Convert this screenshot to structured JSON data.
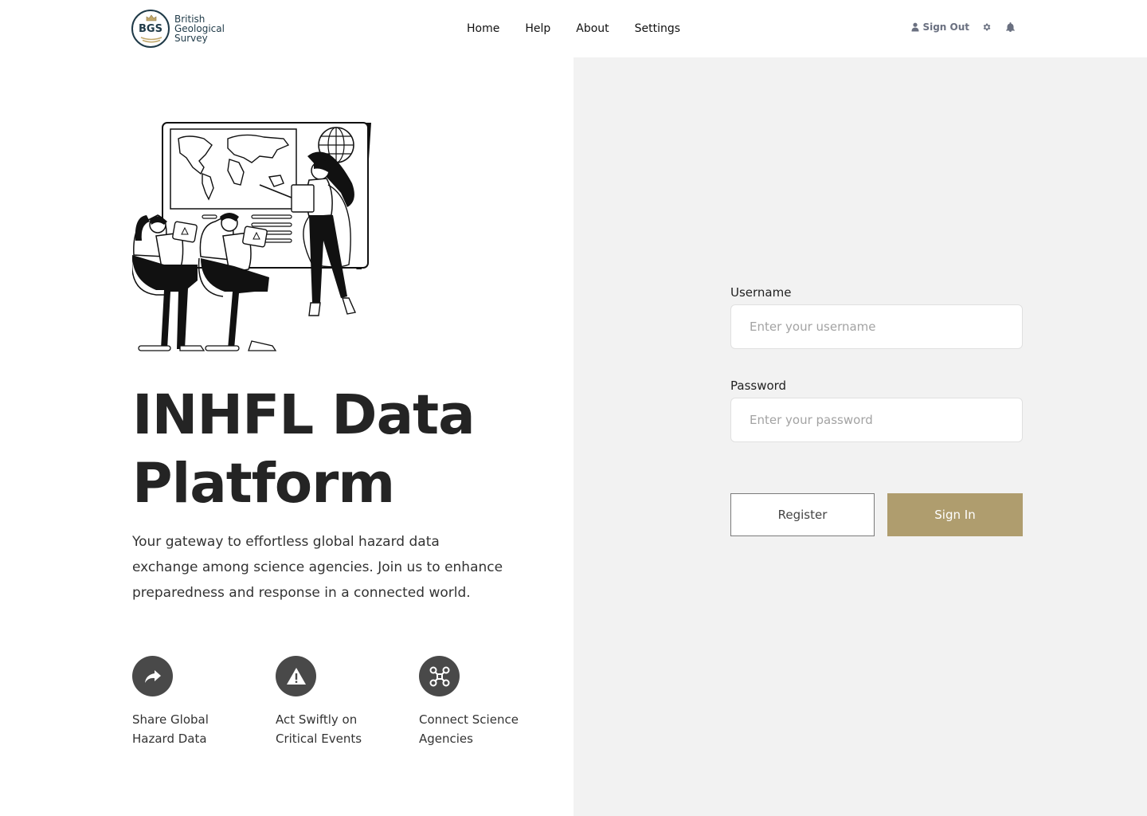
{
  "header": {
    "logo": {
      "abbr": "BGS",
      "words": [
        "British",
        "Geological",
        "Survey"
      ]
    },
    "nav": [
      {
        "label": "Home"
      },
      {
        "label": "Help"
      },
      {
        "label": "About"
      },
      {
        "label": "Settings"
      }
    ],
    "user_tools": {
      "sign_out_label": "Sign Out",
      "icons": [
        "user-icon",
        "gear-icon",
        "bell-icon"
      ]
    }
  },
  "hero": {
    "title_line1": "INHFL Data",
    "title_line2": "Platform",
    "subtitle": "Your gateway to effortless global hazard data exchange among science agencies. Join us to enhance preparedness and response in a connected world.",
    "features": [
      {
        "icon": "share-arrow-icon",
        "line1": "Share Global",
        "line2": "Hazard Data"
      },
      {
        "icon": "warning-triangle-icon",
        "line1": "Act Swiftly on",
        "line2": "Critical Events"
      },
      {
        "icon": "network-nodes-icon",
        "line1": "Connect Science",
        "line2": "Agencies"
      }
    ]
  },
  "login": {
    "username_label": "Username",
    "username_placeholder": "Enter your username",
    "password_label": "Password",
    "password_placeholder": "Enter your password",
    "register_label": "Register",
    "signin_label": "Sign In"
  },
  "colors": {
    "accent_gold": "#af9d6e",
    "panel_gray": "#f2f2f2",
    "icon_dark": "#494949",
    "brand_navy": "#1f3a48"
  }
}
